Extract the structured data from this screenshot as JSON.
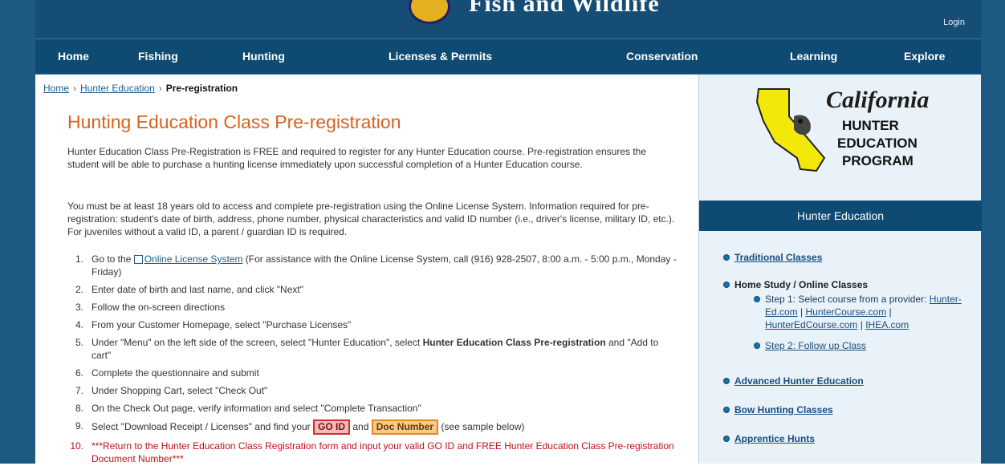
{
  "header": {
    "banner_title": "Fish and Wildlife",
    "login_label": "Login"
  },
  "nav": {
    "items": [
      {
        "label": "Home"
      },
      {
        "label": "Fishing"
      },
      {
        "label": "Hunting"
      },
      {
        "label": "Licenses & Permits"
      },
      {
        "label": "Conservation"
      },
      {
        "label": "Learning"
      },
      {
        "label": "Explore"
      }
    ]
  },
  "breadcrumb": {
    "home": "Home",
    "section": "Hunter Education",
    "current": "Pre-registration"
  },
  "main": {
    "title": "Hunting Education Class Pre-registration",
    "intro": "Hunter Education Class Pre-Registration is FREE and required to register for any Hunter Education course. Pre-registration ensures the student will be able to purchase a hunting license immediately upon successful completion of a Hunter Education course.",
    "requirements": "You must be at least 18 years old to access and complete pre-registration using the Online License System. Information required for pre-registration: student's date of birth, address, phone number, physical characteristics and valid ID number (i.e., driver's license, military ID, etc.). For juveniles without a valid ID, a parent / guardian ID is required.",
    "steps": [
      {
        "num": "1.",
        "pre": "Go to the",
        "link": "Online License System",
        "post": "(For assistance with the Online License System, call (916) 928-2507, 8:00 a.m. - 5:00 p.m., Monday - Friday)"
      },
      {
        "num": "2.",
        "text": "Enter date of birth and last name, and click \"Next\""
      },
      {
        "num": "3.",
        "text": "Follow the on-screen directions"
      },
      {
        "num": "4.",
        "text": "From your Customer Homepage, select \"Purchase Licenses\""
      },
      {
        "num": "5.",
        "pre": "Under \"Menu\" on the left side of the screen, select \"Hunter Education\", select",
        "bold": "Hunter Education Class Pre-registration",
        "post": "and \"Add to cart\""
      },
      {
        "num": "6.",
        "text": "Complete the questionnaire and submit"
      },
      {
        "num": "7.",
        "text": "Under Shopping Cart, select \"Check Out\""
      },
      {
        "num": "8.",
        "text": "On the Check Out page, verify information and select \"Complete Transaction\""
      },
      {
        "num": "9.",
        "pre": "Select \"Download Receipt / Licenses\" and find your",
        "badge1": "GO ID",
        "mid": "and",
        "badge2": "Doc Number",
        "post": "(see sample below)"
      },
      {
        "num": "10.",
        "text": "***Return to the Hunter Education Class Registration form and input your valid GO ID and FREE Hunter Education Class Pre-registration Document Number***"
      }
    ]
  },
  "sidebar": {
    "logo": {
      "line1": "California",
      "line2": "HUNTER",
      "line3": "EDUCATION",
      "line4": "PROGRAM"
    },
    "header": "Hunter Education",
    "items": [
      {
        "label": "Traditional Classes"
      },
      {
        "label": "Home Study / Online Classes"
      },
      {
        "label": "Advanced Hunter Education"
      },
      {
        "label": "Bow Hunting Classes"
      },
      {
        "label": "Apprentice Hunts"
      }
    ],
    "sub": {
      "step1_text": "Step 1: Select course from a provider:",
      "providers": [
        "Hunter-Ed.com",
        "HunterCourse.com",
        "HunterEdCourse.com",
        "IHEA.com"
      ],
      "step2": "Step 2: Follow up Class"
    }
  },
  "colors": {
    "nav_bg": "#0e4a72",
    "title_orange": "#d8621e",
    "link_blue": "#1a5d8f",
    "sidebar_bg": "#e9f2f8",
    "step10_red": "#c0101a"
  }
}
